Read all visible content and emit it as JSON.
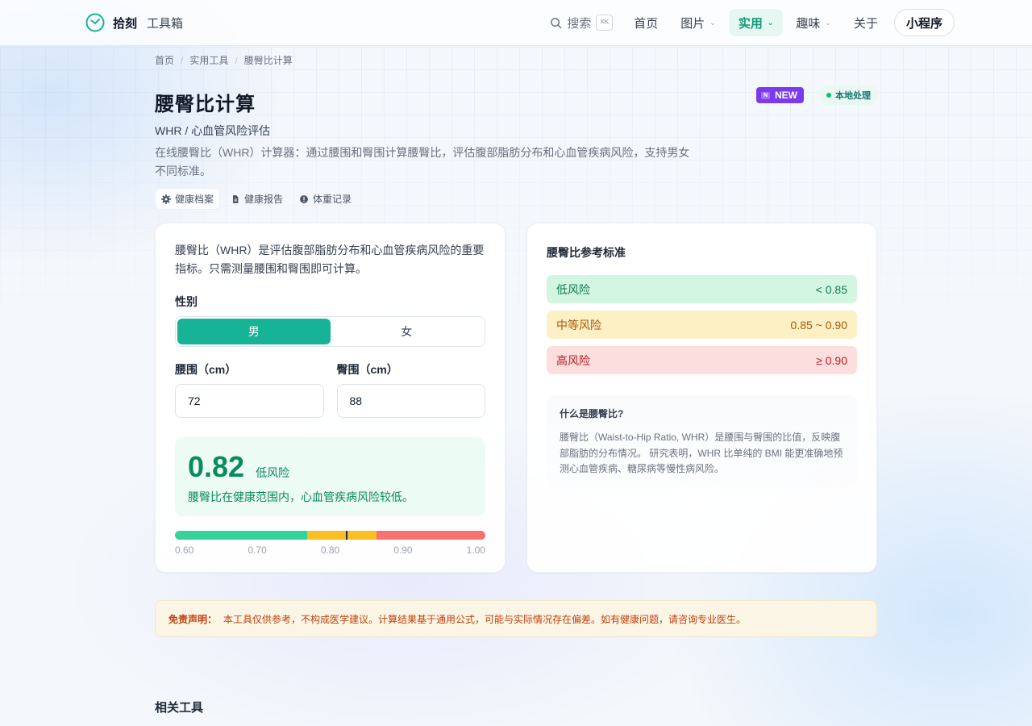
{
  "header": {
    "brand": "拾刻",
    "brand_sub": "工具箱",
    "search_label": "搜索",
    "search_shortcut": "⌘K",
    "nav": [
      {
        "label": "首页",
        "dropdown": false,
        "active": false
      },
      {
        "label": "图片",
        "dropdown": true,
        "active": false
      },
      {
        "label": "实用",
        "dropdown": true,
        "active": true
      },
      {
        "label": "趣味",
        "dropdown": true,
        "active": false
      },
      {
        "label": "关于",
        "dropdown": false,
        "active": false
      }
    ],
    "mini_program": "小程序"
  },
  "breadcrumb": [
    "首页",
    "实用工具",
    "腰臀比计算"
  ],
  "page": {
    "title": "腰臀比计算",
    "subtitle": "WHR / 心血管风险评估",
    "description": "在线腰臀比（WHR）计算器：通过腰围和臀围计算腰臀比，评估腹部脂肪分布和心血管疾病风险，支持男女不同标准。",
    "badge_new_icon": "N",
    "badge_new": "NEW",
    "badge_local": "本地处理",
    "chips": [
      {
        "label": "健康档案",
        "icon": "gear-icon"
      },
      {
        "label": "健康报告",
        "icon": "document-icon"
      },
      {
        "label": "体重记录",
        "icon": "alert-circle-icon"
      }
    ]
  },
  "calculator": {
    "intro": "腰臀比（WHR）是评估腹部脂肪分布和心血管疾病风险的重要指标。只需测量腰围和臀围即可计算。",
    "gender_label": "性别",
    "gender_options": [
      "男",
      "女"
    ],
    "gender_selected": "男",
    "waist_label": "腰围（cm）",
    "waist_value": "72",
    "hip_label": "臀围（cm）",
    "hip_value": "88",
    "result_value": "0.82",
    "result_level": "低风险",
    "result_message": "腰臀比在健康范围内，心血管疾病风险较低。",
    "gauge": {
      "min": 0.6,
      "max": 1.0,
      "value": 0.82,
      "segments": [
        {
          "from": 0.6,
          "to": 0.77,
          "color": "#34d399"
        },
        {
          "from": 0.77,
          "to": 0.86,
          "color": "#fbbf24"
        },
        {
          "from": 0.86,
          "to": 1.0,
          "color": "#f87171"
        }
      ],
      "ticks": [
        "0.60",
        "0.70",
        "0.80",
        "0.90",
        "1.00"
      ]
    }
  },
  "reference": {
    "title": "腰臀比参考标准",
    "rows": [
      {
        "level": "低风险",
        "range": "< 0.85"
      },
      {
        "level": "中等风险",
        "range": "0.85 ~ 0.90"
      },
      {
        "level": "高风险",
        "range": "≥ 0.90"
      }
    ],
    "info_title": "什么是腰臀比?",
    "info_text": "腰臀比（Waist-to-Hip Ratio, WHR）是腰围与臀围的比值，反映腹部脂肪的分布情况。 研究表明，WHR 比单纯的 BMI 能更准确地预测心血管疾病、糖尿病等慢性病风险。"
  },
  "disclaimer": {
    "label": "免责声明：",
    "text": "本工具仅供参考，不构成医学建议。计算结果基于通用公式，可能与实际情况存在偏差。如有健康问题，请咨询专业医生。"
  },
  "related": {
    "title": "相关工具"
  },
  "colors": {
    "accent": "#17b397",
    "low": "#0a8a5f",
    "badge_new": "#7c3aed"
  }
}
